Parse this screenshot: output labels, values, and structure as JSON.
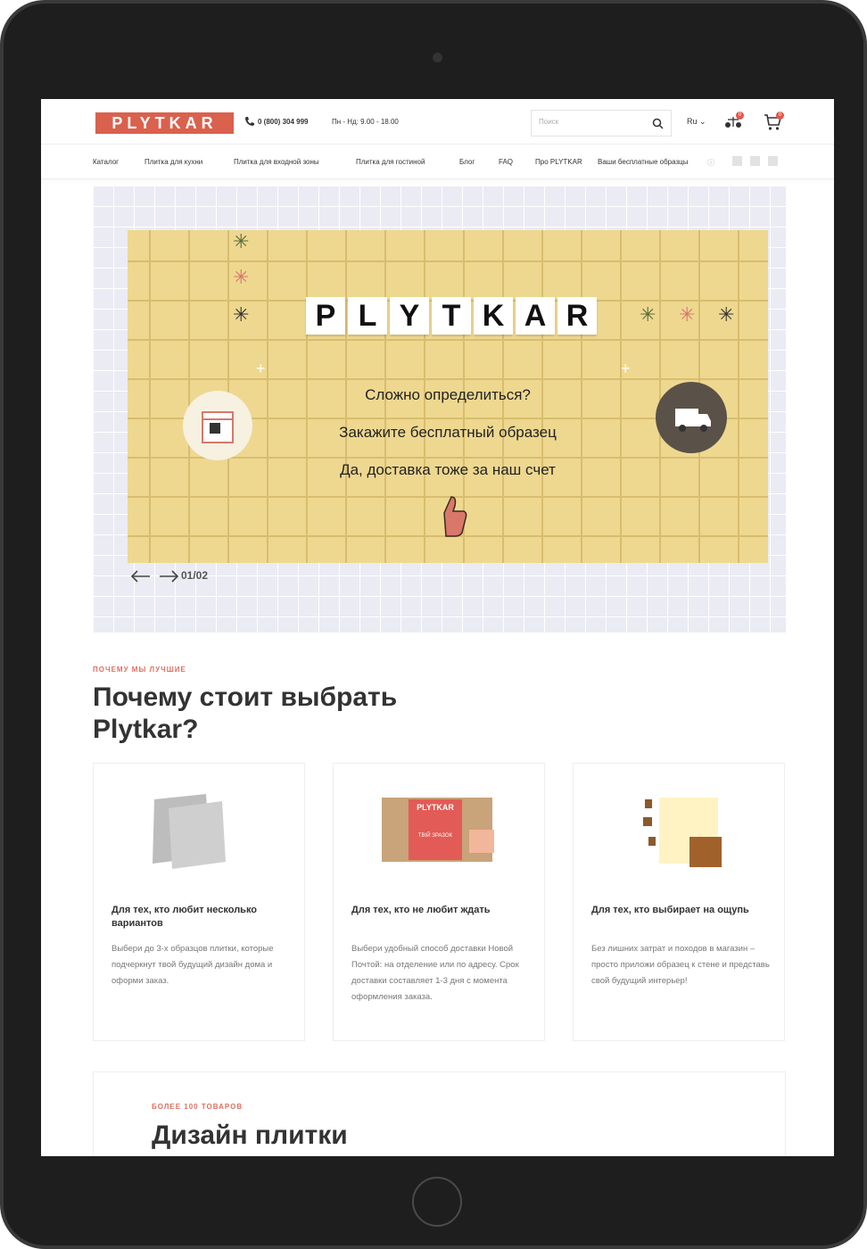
{
  "header": {
    "logo": "PLYTKAR",
    "phone": "0 (800) 304 999",
    "hours": "Пн - Нд: 9.00 - 18.00",
    "search_placeholder": "Поиск",
    "lang": "Ru",
    "compare_count": "0",
    "cart_count": "0"
  },
  "nav": {
    "items": [
      "Каталог",
      "Плитка для кухни",
      "Плитка для входной зоны",
      "Плитка для гостиной",
      "Блог",
      "FAQ",
      "Про PLYTKAR",
      "Ваши бесплатные образцы"
    ]
  },
  "banner": {
    "tiles": [
      "P",
      "L",
      "Y",
      "T",
      "K",
      "A",
      "R"
    ],
    "line1": "Сложно определиться?",
    "line2": "Закажите бесплатный образец",
    "line3": "Да, доставка тоже за наш счет",
    "counter": "01/02"
  },
  "why": {
    "kicker": "ПОЧЕМУ МЫ ЛУЧШИЕ",
    "title": "Почему стоит выбрать Plytkar?",
    "cards": [
      {
        "title": "Для тех, кто любит несколько вариантов",
        "text": "Выбери до 3-х образцов плитки, которые подчеркнут твой будущий дизайн дома и оформи заказ."
      },
      {
        "title": "Для тех, кто не любит ждать",
        "text": "Выбери удобный способ доставки Новой Почтой: на отделение или по адресу. Срок доставки составляет 1-3 дня с момента оформления заказа."
      },
      {
        "title": "Для тех, кто выбирает на ощупь",
        "text": "Без лишних затрат и походов в магазин – просто приложи образец к стене и представь свой будущий интерьер!"
      }
    ],
    "card2_box_label": "PLYTKAR",
    "card2_box_sub": "ТВІЙ ЗРАЗОК"
  },
  "more": {
    "kicker": "БОЛЕЕ 100 ТОВАРОВ",
    "title": "Дизайн плитки"
  }
}
